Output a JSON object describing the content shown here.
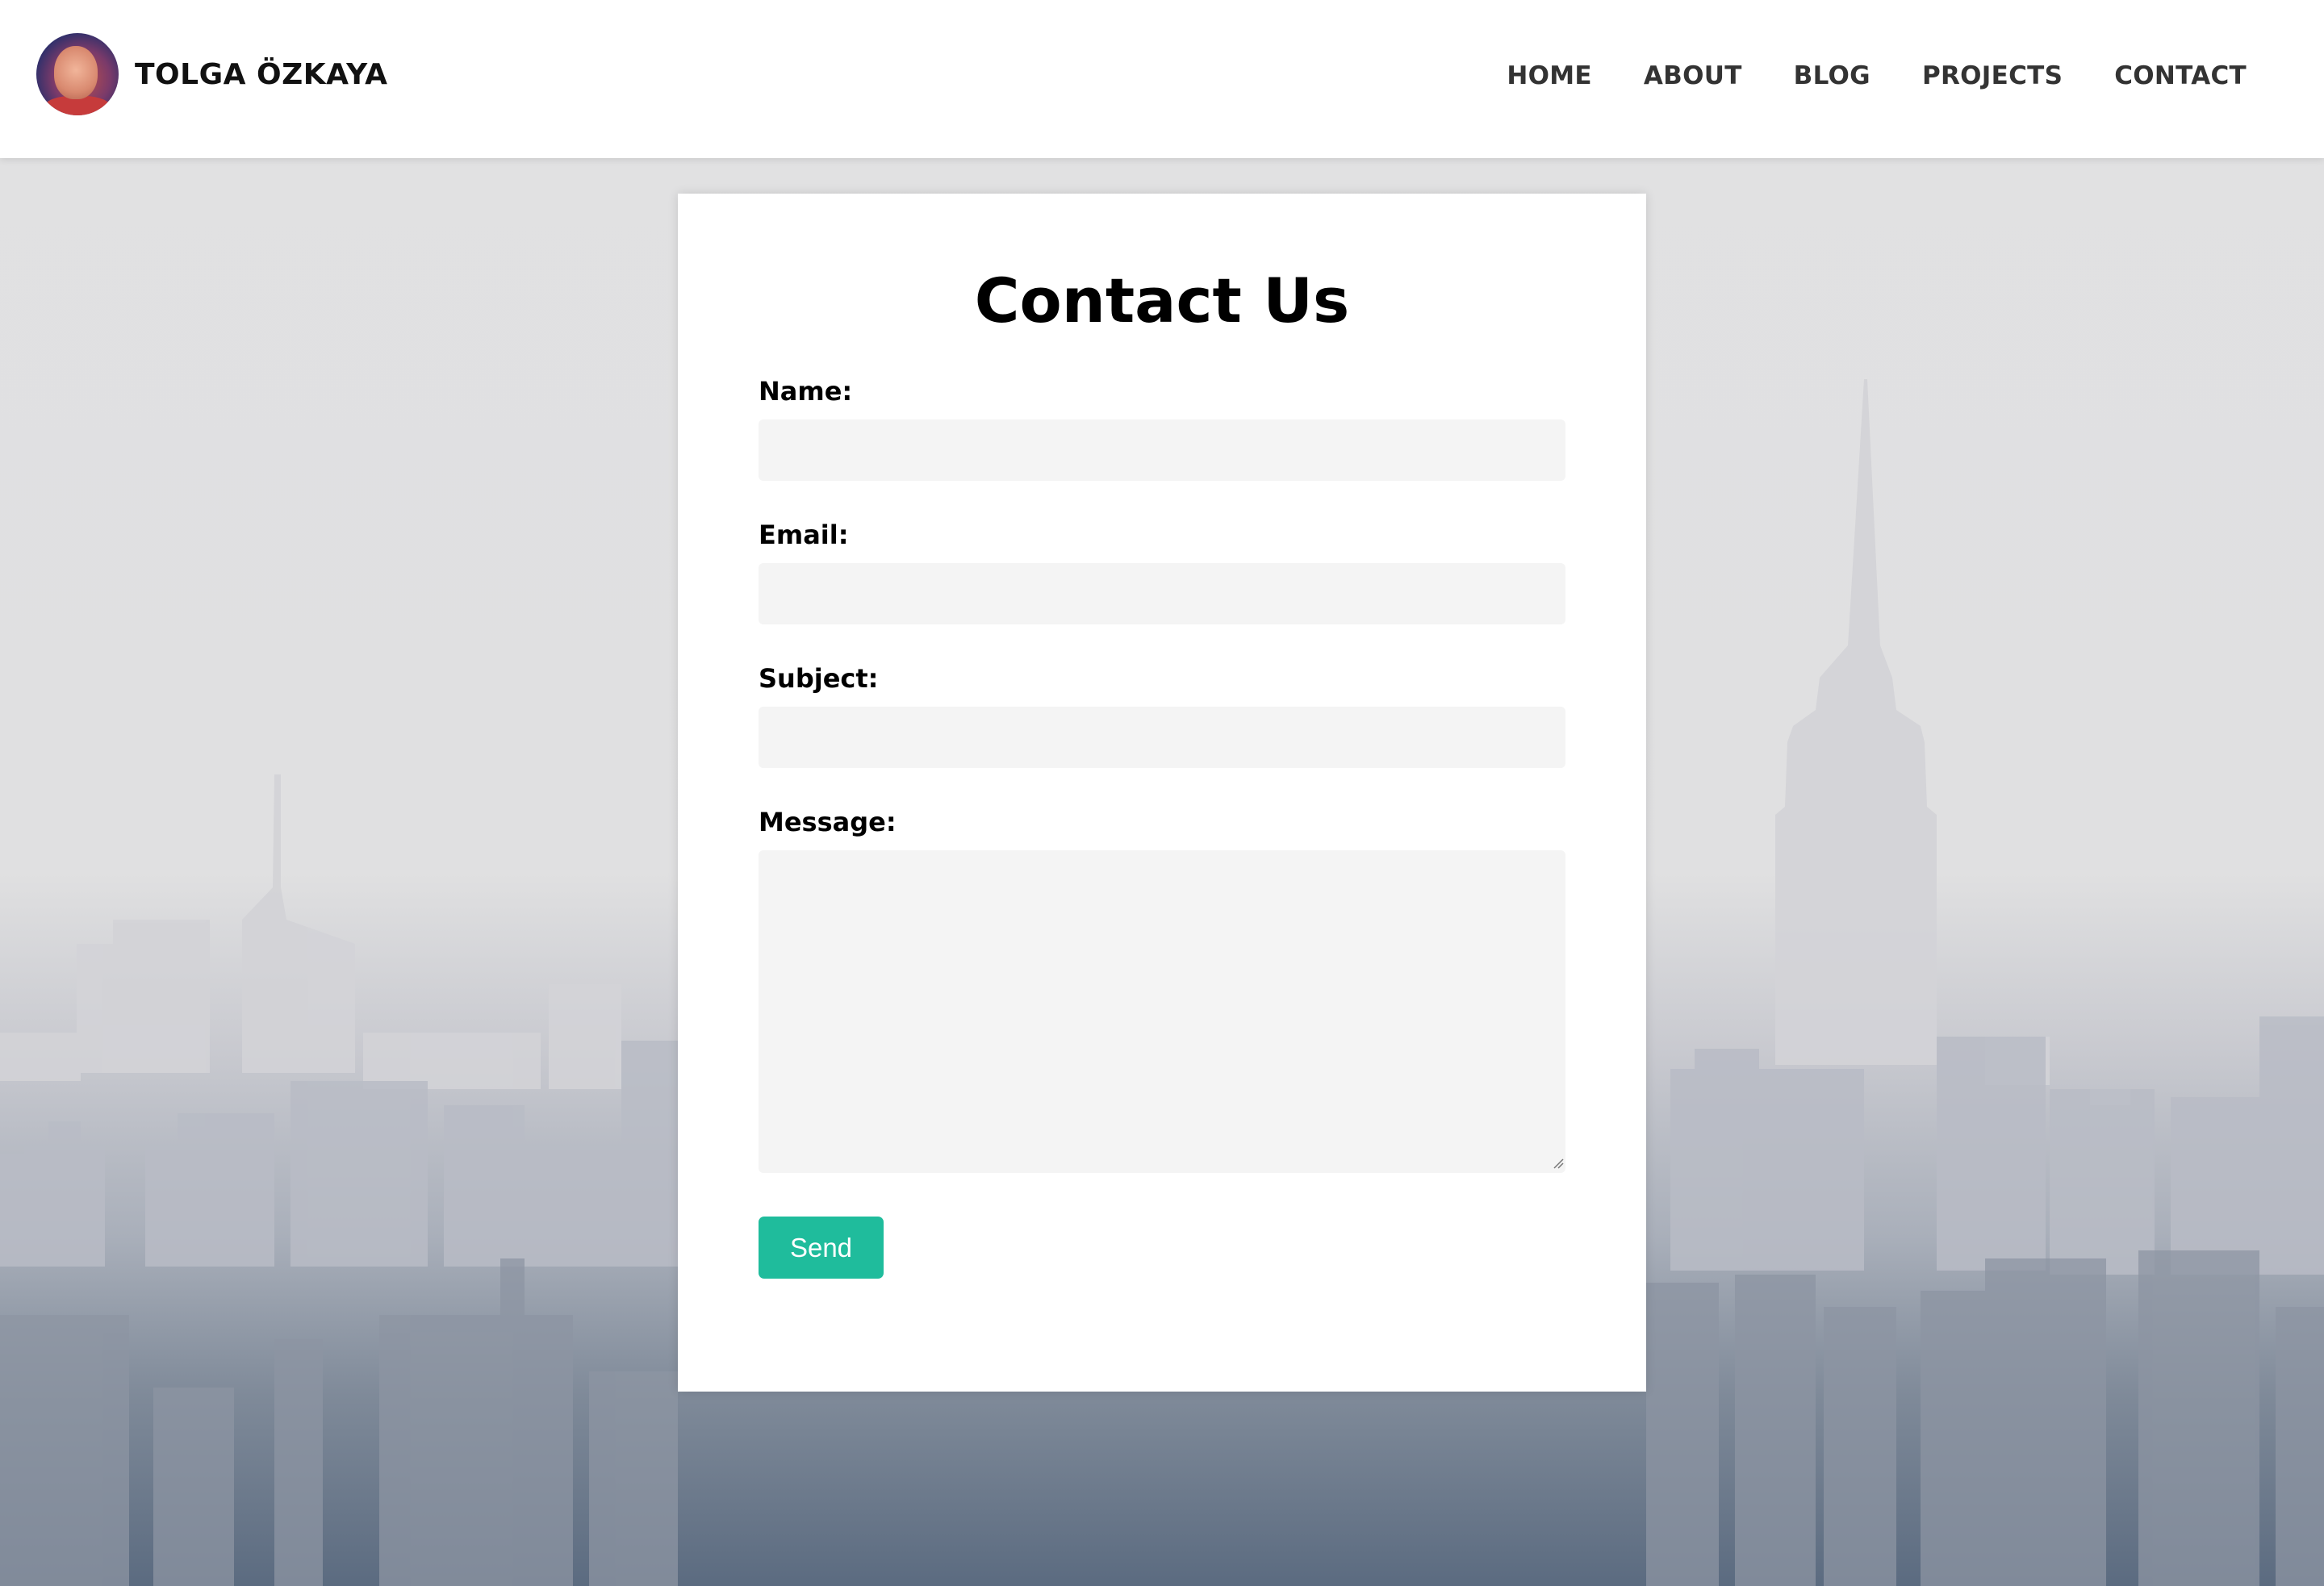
{
  "header": {
    "brand_name": "TOLGA ÖZKAYA",
    "nav": [
      {
        "label": "HOME"
      },
      {
        "label": "ABOUT"
      },
      {
        "label": "BLOG"
      },
      {
        "label": "PROJECTS"
      },
      {
        "label": "CONTACT"
      }
    ]
  },
  "contact_form": {
    "title": "Contact Us",
    "name_label": "Name:",
    "name_value": "",
    "email_label": "Email:",
    "email_value": "",
    "subject_label": "Subject:",
    "subject_value": "",
    "message_label": "Message:",
    "message_value": "",
    "send_label": "Send"
  },
  "colors": {
    "accent": "#1fbc9c",
    "header_bg": "#ffffff",
    "input_bg": "#f4f4f4",
    "text": "#000000",
    "nav_text": "#333333"
  },
  "icons": {
    "textarea_resize": "resize-grip-icon"
  }
}
